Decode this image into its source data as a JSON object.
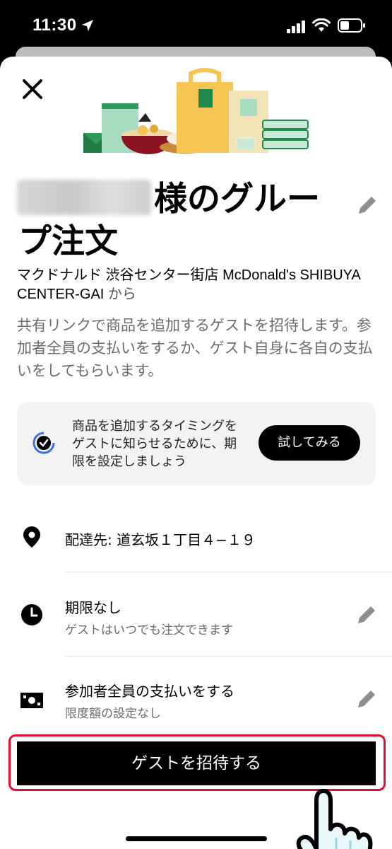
{
  "status_bar": {
    "time": "11:30"
  },
  "group_order": {
    "title": "様のグループ注文",
    "restaurant_name": "マクドナルド 渋谷センター街店 McDonald's SHIBUYA CENTER-GAI",
    "restaurant_suffix": "から",
    "description": "共有リンクで商品を追加するゲストを招待します。参加者全員の支払いをするか、ゲスト自身に各自の支払いをしてもらいます。"
  },
  "tip": {
    "text": "商品を追加するタイミングをゲストに知らせるために、期限を設定しましょう",
    "button_label": "試してみる"
  },
  "settings": [
    {
      "icon": "location-pin-icon",
      "main": "配達先: 道玄坂１丁目４−１９",
      "sub": ""
    },
    {
      "icon": "clock-icon",
      "main": "期限なし",
      "sub": "ゲストはいつでも注文できます"
    },
    {
      "icon": "cash-icon",
      "main": "参加者全員の支払いをする",
      "sub": "限度額の設定なし"
    }
  ],
  "cta_label": "ゲストを招待する",
  "colors": {
    "accent": "#000000",
    "highlight": "#e0102e",
    "hero_green": "#1f8a4c",
    "hero_yellow": "#f6c452"
  }
}
